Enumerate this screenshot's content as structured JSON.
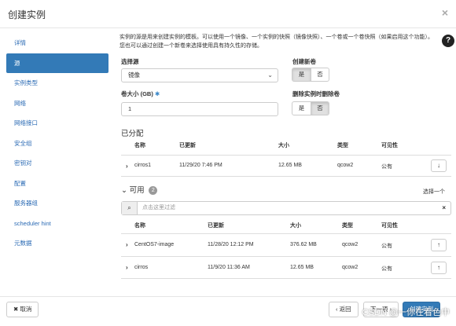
{
  "window": {
    "title": "创建实例",
    "close": "×"
  },
  "sidebar": {
    "items": [
      {
        "label": "详情"
      },
      {
        "label": "源"
      },
      {
        "label": "实例类型"
      },
      {
        "label": "网络"
      },
      {
        "label": "网络接口"
      },
      {
        "label": "安全组"
      },
      {
        "label": "密钥对"
      },
      {
        "label": "配置"
      },
      {
        "label": "服务器组"
      },
      {
        "label": "scheduler hint"
      },
      {
        "label": "元数据"
      }
    ],
    "active_index": 1
  },
  "main": {
    "description": "实例的源是用来创建实例的模板。可以使用一个镜像、一个实例的快照（镜像快照）、一个卷或一个卷快照（如果启用这个功能）。您也可以通过创建一个新卷来选择使用具有持久性的存储。",
    "help": "?",
    "select_source": {
      "label": "选择源",
      "value": "镜像"
    },
    "create_volume": {
      "label": "创建新卷",
      "yes": "是",
      "no": "否",
      "selected": "yes"
    },
    "volume_size": {
      "label": "卷大小 (GB)",
      "required": "✱",
      "value": "1"
    },
    "delete_volume": {
      "label": "删除实例时删除卷",
      "yes": "是",
      "no": "否",
      "selected": "no"
    },
    "allocated": {
      "title": "已分配",
      "columns": [
        "名称",
        "已更新",
        "大小",
        "类型",
        "可见性"
      ],
      "rows": [
        {
          "name": "cirros1",
          "updated": "11/29/20 7:46 PM",
          "size": "12.65 MB",
          "type": "qcow2",
          "visibility": "公有"
        }
      ]
    },
    "available": {
      "title": "可用",
      "count": "2",
      "select_one": "选择一个",
      "filter_placeholder": "点击这里过滤",
      "columns": [
        "名称",
        "已更新",
        "大小",
        "类型",
        "可见性"
      ],
      "rows": [
        {
          "name": "CentOS7-image",
          "updated": "11/28/20 12:12 PM",
          "size": "376.62 MB",
          "type": "qcow2",
          "visibility": "公有"
        },
        {
          "name": "cirros",
          "updated": "11/9/20 11:36 AM",
          "size": "12.65 MB",
          "type": "qcow2",
          "visibility": "公有"
        }
      ]
    }
  },
  "footer": {
    "cancel": "✖ 取消",
    "back": "‹ 返回",
    "next": "下一项 ›",
    "create": "创建实例"
  },
  "watermark": "CSDN @一你在看色中"
}
